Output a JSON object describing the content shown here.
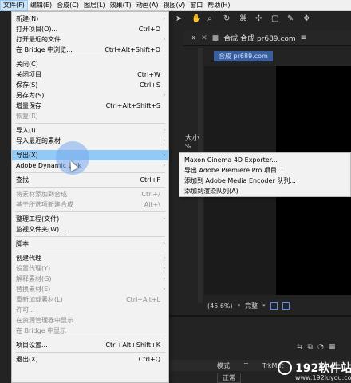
{
  "menubar": [
    {
      "label": "文件(F)",
      "active": true
    },
    {
      "label": "编辑(E)"
    },
    {
      "label": "合成(C)"
    },
    {
      "label": "图层(L)"
    },
    {
      "label": "效果(T)"
    },
    {
      "label": "动画(A)"
    },
    {
      "label": "视图(V)"
    },
    {
      "label": "窗口"
    },
    {
      "label": "帮助(H)"
    }
  ],
  "file_menu": {
    "items": [
      {
        "label": "新建(N)",
        "shortcut": "",
        "submenu": true,
        "disabled": false
      },
      {
        "label": "打开项目(O)...",
        "shortcut": "Ctrl+O",
        "submenu": false,
        "disabled": false
      },
      {
        "label": "打开最近的文件",
        "shortcut": "",
        "submenu": true,
        "disabled": false
      },
      {
        "label": "在 Bridge 中浏览...",
        "shortcut": "Ctrl+Alt+Shift+O",
        "submenu": false,
        "disabled": false
      },
      {
        "label": "关闭(C)",
        "shortcut": "",
        "submenu": false,
        "disabled": false
      },
      {
        "label": "关闭项目",
        "shortcut": "Ctrl+W",
        "submenu": false,
        "disabled": false
      },
      {
        "label": "保存(S)",
        "shortcut": "Ctrl+S",
        "submenu": false,
        "disabled": false
      },
      {
        "label": "另存为(S)",
        "shortcut": "",
        "submenu": true,
        "disabled": false
      },
      {
        "label": "增量保存",
        "shortcut": "Ctrl+Alt+Shift+S",
        "submenu": false,
        "disabled": false
      },
      {
        "label": "恢复(R)",
        "shortcut": "",
        "submenu": false,
        "disabled": true
      },
      {
        "label": "导入(I)",
        "shortcut": "",
        "submenu": true,
        "disabled": false
      },
      {
        "label": "导入最近的素材",
        "shortcut": "",
        "submenu": true,
        "disabled": false
      },
      {
        "label": "导出(X)",
        "shortcut": "",
        "submenu": true,
        "disabled": false,
        "highlighted": true
      },
      {
        "label": "Adobe Dynamic Link",
        "shortcut": "",
        "submenu": true,
        "disabled": false
      },
      {
        "label": "查找",
        "shortcut": "Ctrl+F",
        "submenu": false,
        "disabled": false
      },
      {
        "label": "将素材添加到合成",
        "shortcut": "Ctrl+/",
        "submenu": false,
        "disabled": true
      },
      {
        "label": "基于所选项新建合成",
        "shortcut": "Alt+\\",
        "submenu": false,
        "disabled": true
      },
      {
        "label": "整理工程(文件)",
        "shortcut": "",
        "submenu": true,
        "disabled": false
      },
      {
        "label": "监视文件夹(W)...",
        "shortcut": "",
        "submenu": false,
        "disabled": false
      },
      {
        "label": "脚本",
        "shortcut": "",
        "submenu": true,
        "disabled": false
      },
      {
        "label": "创建代理",
        "shortcut": "",
        "submenu": true,
        "disabled": false
      },
      {
        "label": "设置代理(Y)",
        "shortcut": "",
        "submenu": true,
        "disabled": true
      },
      {
        "label": "解释素材(G)",
        "shortcut": "",
        "submenu": true,
        "disabled": true
      },
      {
        "label": "替换素材(E)",
        "shortcut": "",
        "submenu": true,
        "disabled": true
      },
      {
        "label": "重新加载素材(L)",
        "shortcut": "Ctrl+Alt+L",
        "submenu": false,
        "disabled": true
      },
      {
        "label": "许可...",
        "shortcut": "",
        "submenu": false,
        "disabled": true
      },
      {
        "label": "在资源管理器中显示",
        "shortcut": "",
        "submenu": false,
        "disabled": true
      },
      {
        "label": "在 Bridge 中显示",
        "shortcut": "",
        "submenu": false,
        "disabled": true
      },
      {
        "label": "项目设置...",
        "shortcut": "Ctrl+Alt+Shift+K",
        "submenu": false,
        "disabled": false
      },
      {
        "label": "退出(X)",
        "shortcut": "Ctrl+Q",
        "submenu": false,
        "disabled": false
      }
    ]
  },
  "export_submenu": {
    "items": [
      {
        "label": "Maxon Cinema 4D Exporter..."
      },
      {
        "label": "导出 Adobe Premiere Pro 项目..."
      },
      {
        "label": "添加到 Adobe Media Encoder 队列..."
      },
      {
        "label": "添加到渲染队列(A)"
      }
    ]
  },
  "composition_panel": {
    "tab_title": "合成",
    "tab_name": "合成 pr689.com",
    "chip_label": "合成 pr689.com",
    "side_label": "大小",
    "side_pct": "%",
    "zoom": "(45.6%)",
    "quality": "完整"
  },
  "timeline": {
    "col_mode": "模式",
    "col_t": "T",
    "col_trk": "TrkMat",
    "row_mode": "正常"
  },
  "watermark": {
    "brand": "192软件站",
    "domain": "www.192luyou.com"
  },
  "colors": {
    "menu_bg": "#f2f2f2",
    "menu_highlight": "#91c9f7",
    "app_bg": "#232323",
    "accent_blue": "#3a5f9e"
  }
}
